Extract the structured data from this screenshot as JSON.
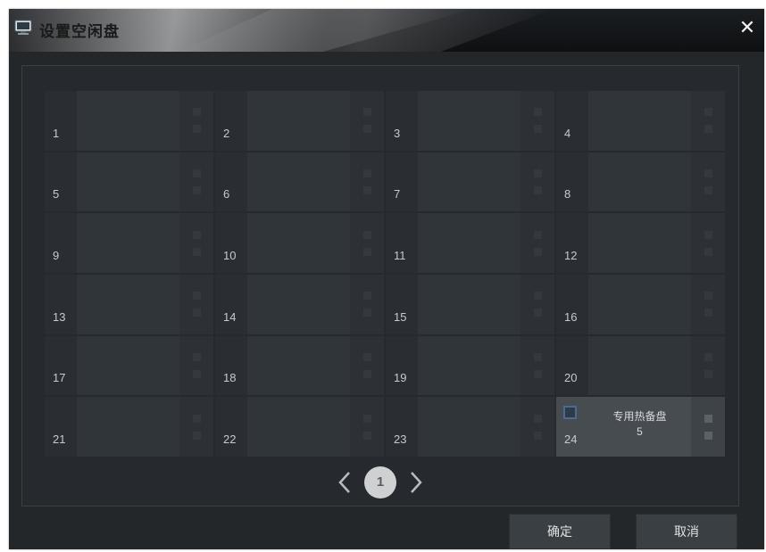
{
  "window": {
    "title": "设置空闲盘",
    "close_label": "✕"
  },
  "slots": [
    {
      "num": "1"
    },
    {
      "num": "2"
    },
    {
      "num": "3"
    },
    {
      "num": "4"
    },
    {
      "num": "5"
    },
    {
      "num": "6"
    },
    {
      "num": "7"
    },
    {
      "num": "8"
    },
    {
      "num": "9"
    },
    {
      "num": "10"
    },
    {
      "num": "11"
    },
    {
      "num": "12"
    },
    {
      "num": "13"
    },
    {
      "num": "14"
    },
    {
      "num": "15"
    },
    {
      "num": "16"
    },
    {
      "num": "17"
    },
    {
      "num": "18"
    },
    {
      "num": "19"
    },
    {
      "num": "20"
    },
    {
      "num": "21"
    },
    {
      "num": "22"
    },
    {
      "num": "23"
    },
    {
      "num": "24",
      "disk_type": "专用热备盘",
      "disk_index": "5",
      "checked": false
    }
  ],
  "pager": {
    "current_page": "1"
  },
  "buttons": {
    "ok": "确定",
    "cancel": "取消"
  },
  "colors": {
    "checkbox_border": "#4c6a8e",
    "window_bg": "#23272a"
  }
}
